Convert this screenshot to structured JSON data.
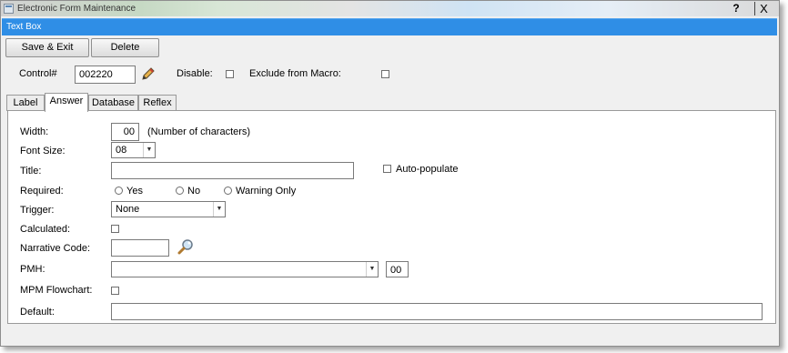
{
  "window": {
    "title": "Electronic Form Maintenance",
    "help": "?",
    "close": "X"
  },
  "section_bar": {
    "title": "Text Box"
  },
  "toolbar": {
    "save_exit": "Save & Exit",
    "delete": "Delete"
  },
  "header": {
    "control_label": "Control#",
    "control_value": "002220",
    "disable_label": "Disable:",
    "disable_checked": false,
    "exclude_label": "Exclude from Macro:",
    "exclude_checked": false
  },
  "tabs": [
    {
      "label": "Label",
      "active": false
    },
    {
      "label": "Answer",
      "active": true
    },
    {
      "label": "Database",
      "active": false
    },
    {
      "label": "Reflex",
      "active": false
    }
  ],
  "answer": {
    "width_label": "Width:",
    "width_value": "00",
    "width_hint": "(Number of characters)",
    "font_size_label": "Font Size:",
    "font_size_value": "08",
    "title_label": "Title:",
    "title_value": "",
    "auto_populate_label": "Auto-populate",
    "auto_populate_checked": false,
    "required_label": "Required:",
    "required_options": [
      "Yes",
      "No",
      "Warning Only"
    ],
    "trigger_label": "Trigger:",
    "trigger_value": "None",
    "calculated_label": "Calculated:",
    "calculated_checked": false,
    "narrative_label": "Narrative Code:",
    "narrative_value": "",
    "pmh_label": "PMH:",
    "pmh_value": "",
    "pmh_number": "00",
    "mpm_label": "MPM Flowchart:",
    "mpm_checked": false,
    "default_label": "Default:",
    "default_value": ""
  }
}
